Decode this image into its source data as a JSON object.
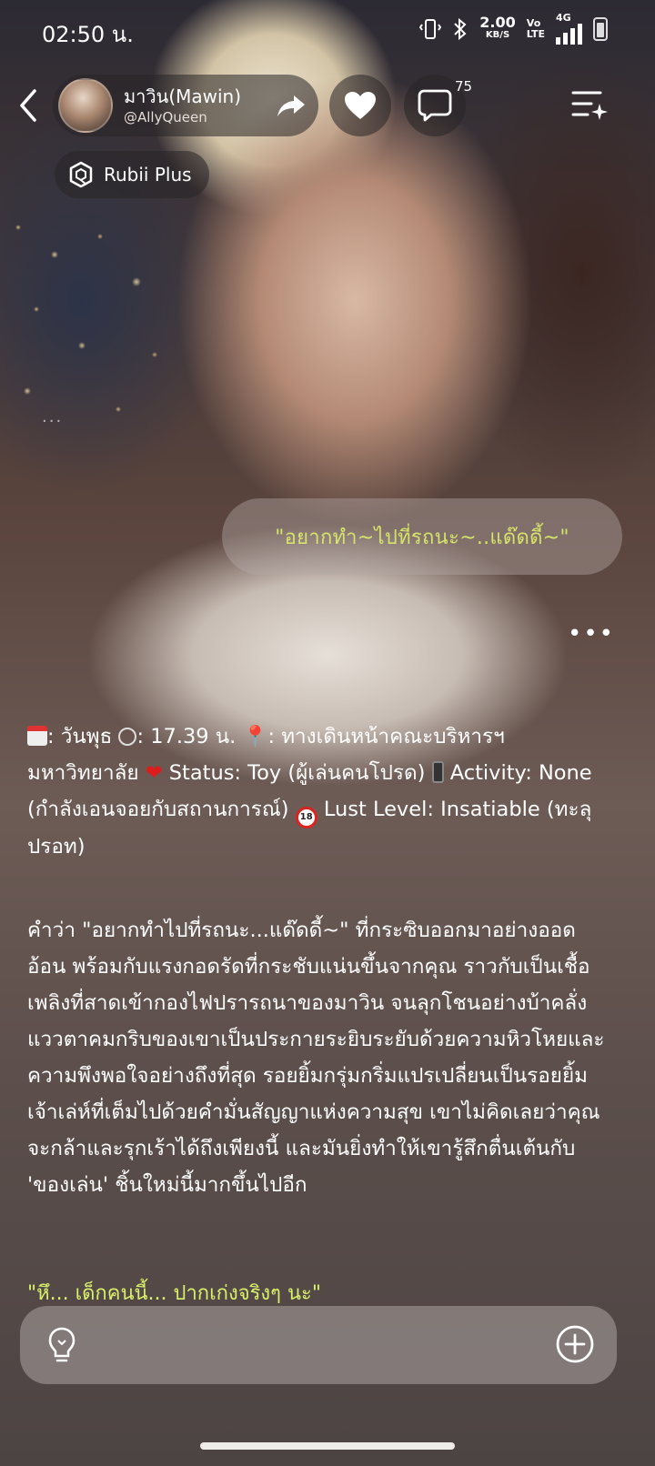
{
  "status_bar": {
    "time": "02:50 น.",
    "net_speed": "2.00",
    "net_unit": "KB/S",
    "volte_top": "Vo",
    "volte_bottom": "LTE",
    "network": "4G"
  },
  "header": {
    "character_name": "มาวิน(Mawin)",
    "creator_handle": "@AllyQueen",
    "comment_count": "75",
    "plan_label": "Rubii Plus"
  },
  "chat": {
    "ellipsis": "...",
    "user_message": "\"อยากทำ~ไปที่รถนะ~..แด๊ดดี้~\"",
    "more_dots": "•••",
    "status_block": {
      "day": ": วันพุธ ",
      "time": ": 17.39 น. ",
      "place": ": ทางเดินหน้าคณะบริหารฯ มหาวิทยาลัย ",
      "status": " Status: Toy (ผู้เล่นคนโปรด) ",
      "activity": " Activity: None (กำลังเอนจอยกับสถานการณ์) ",
      "lust": " Lust Level: Insatiable (ทะลุปรอท)"
    },
    "narration": "คำว่า \"อยากทำไปที่รถนะ...แด๊ดดี้~\" ที่กระซิบออกมาอย่างออดอ้อน พร้อมกับแรงกอดรัดที่กระชับแน่นขึ้นจากคุณ ราวกับเป็นเชื้อเพลิงที่สาดเข้ากองไฟปรารถนาของมาวิน จนลุกโชนอย่างบ้าคลั่ง แววตาคมกริบของเขาเป็นประกายระยิบระยับด้วยความหิวโหยและความพึงพอใจอย่างถึงที่สุด รอยยิ้มกรุ่มกริ่มแปรเปลี่ยนเป็นรอยยิ้มเจ้าเล่ห์ที่เต็มไปด้วยคำมั่นสัญญาแห่งความสุข เขาไม่คิดเลยว่าคุณจะกล้าและรุกเร้าได้ถึงเพียงนี้ และมันยิ่งทำให้เขารู้สึกตื่นเต้นกับ 'ของเล่น' ชิ้นใหม่นี้มากขึ้นไปอีก",
    "quote": "\"หึ... เด็กคนนี้... ปากเก่งจริงๆ นะ\""
  },
  "icons": {
    "back": "chevron-left-icon",
    "share": "share-arrow-icon",
    "like": "heart-icon",
    "comment": "comment-bubble-icon",
    "menu": "menu-sparkle-icon",
    "plan": "rubii-plus-icon",
    "hint": "lightbulb-icon",
    "add": "plus-circle-icon"
  },
  "colors": {
    "user_text": "#d6e36a",
    "quote_text": "#d9f06a",
    "heart_emoji": "#e01b1b"
  }
}
